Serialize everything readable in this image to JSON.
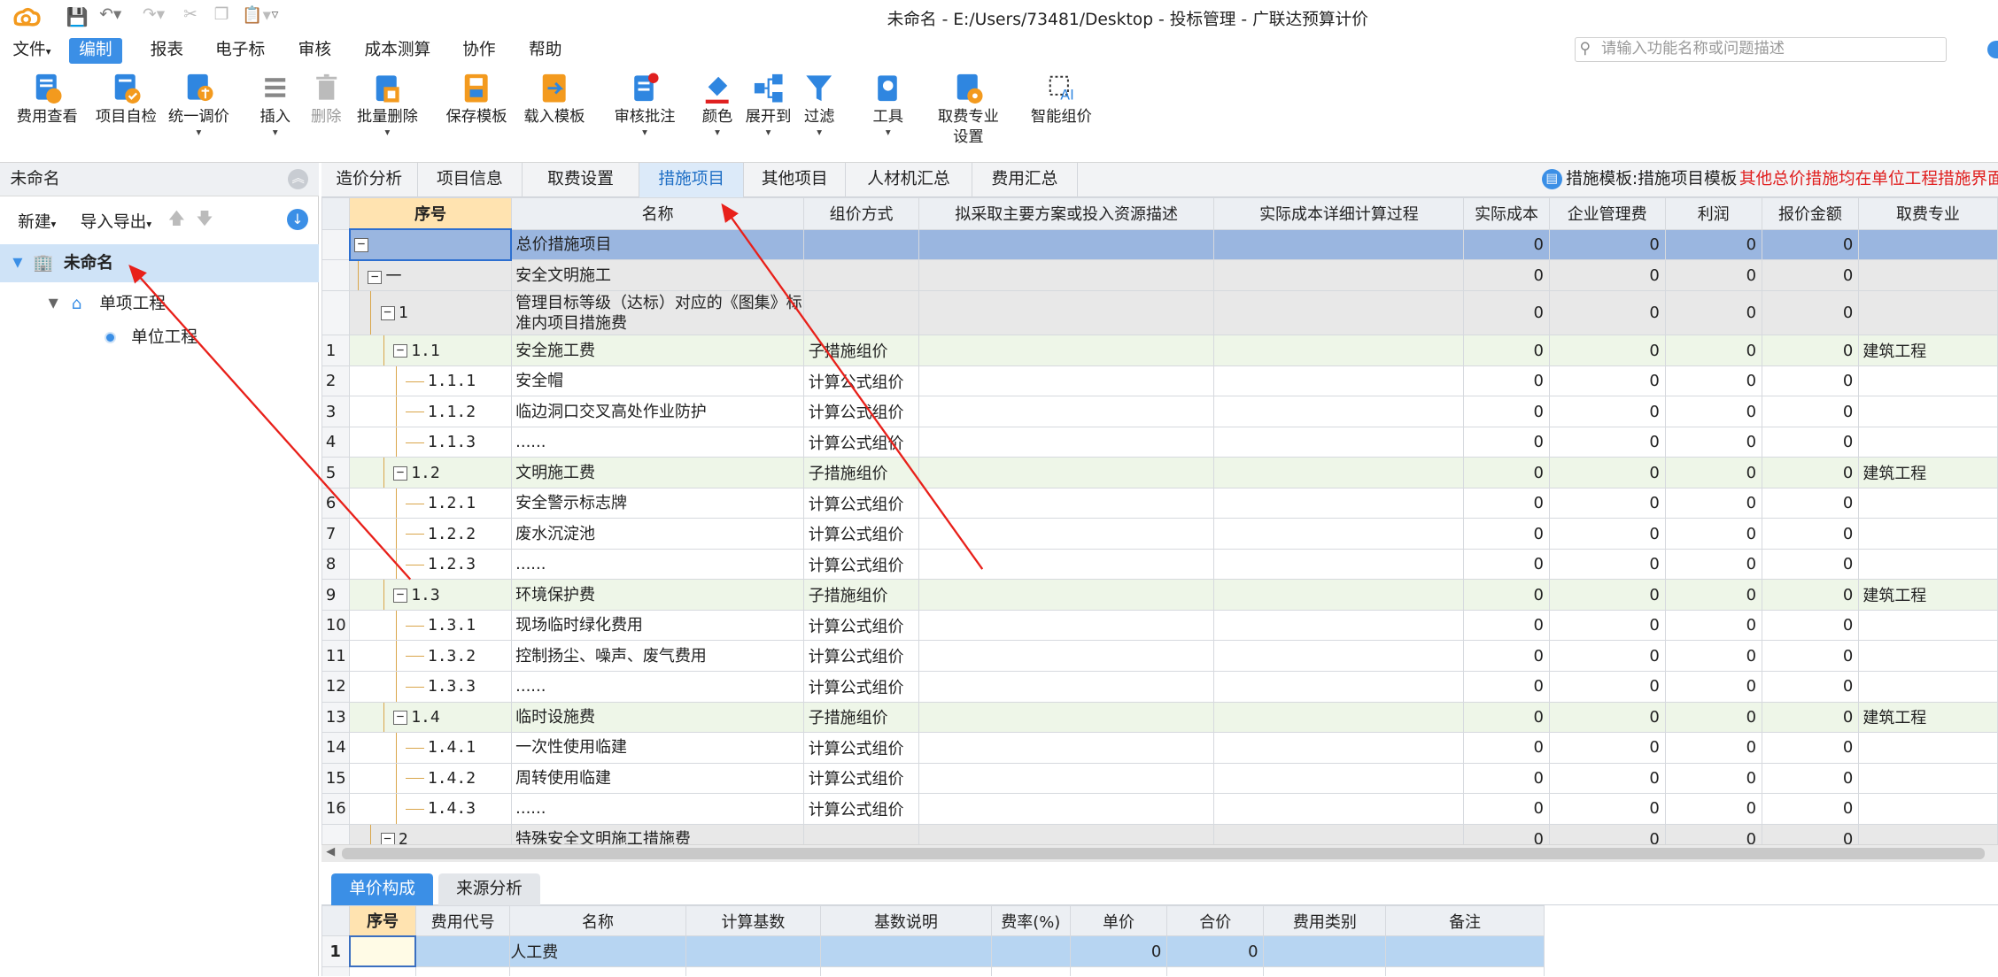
{
  "window": {
    "title": "未命名 - E:/Users/73481/Desktop - 投标管理 - 广联达预算计价"
  },
  "menu": [
    "文件",
    "编制",
    "报表",
    "电子标",
    "审核",
    "成本测算",
    "协作",
    "帮助"
  ],
  "search": {
    "placeholder": "请输入功能名称或问题描述"
  },
  "ribbon": [
    {
      "label": "费用查看",
      "icon": "fee-view-icon"
    },
    {
      "label": "项目自检",
      "icon": "project-check-icon"
    },
    {
      "label": "统一调价",
      "icon": "unified-price-icon"
    },
    {
      "label": "插入",
      "icon": "insert-icon"
    },
    {
      "label": "删除",
      "icon": "delete-icon"
    },
    {
      "label": "批量删除",
      "icon": "batch-delete-icon"
    },
    {
      "label": "保存模板",
      "icon": "save-template-icon"
    },
    {
      "label": "载入模板",
      "icon": "load-template-icon"
    },
    {
      "label": "审核批注",
      "icon": "review-note-icon"
    },
    {
      "label": "颜色",
      "icon": "color-bucket-icon"
    },
    {
      "label": "展开到",
      "icon": "expand-to-icon"
    },
    {
      "label": "过滤",
      "icon": "filter-icon"
    },
    {
      "label": "工具",
      "icon": "tools-icon"
    },
    {
      "label": "取费专业",
      "label2": "设置",
      "icon": "fee-setting-icon"
    },
    {
      "label": "智能组价",
      "icon": "ai-pricing-icon"
    }
  ],
  "sidebar": {
    "header": "未命名",
    "new_label": "新建",
    "import_export_label": "导入导出",
    "tree": [
      {
        "label": "未命名",
        "level": 0
      },
      {
        "label": "单项工程",
        "level": 1
      },
      {
        "label": "单位工程",
        "level": 2
      }
    ]
  },
  "tabs": [
    "造价分析",
    "项目信息",
    "取费设置",
    "措施项目",
    "其他项目",
    "人材机汇总",
    "费用汇总"
  ],
  "template_info": "措施模板:措施项目模板",
  "notice": "其他总价措施均在单位工程措施界面",
  "columns": [
    "序号",
    "名称",
    "组价方式",
    "拟采取主要方案或投入资源描述",
    "实际成本详细计算过程",
    "实际成本",
    "企业管理费",
    "利润",
    "报价金额",
    "取费专业"
  ],
  "rows": [
    {
      "idx": "",
      "code": "",
      "depth": 0,
      "box": "−",
      "name": "总价措施项目",
      "mode": "",
      "cost": "0",
      "mgmt": "0",
      "profit": "0",
      "amount": "0",
      "spec": "",
      "kind": "lvl0"
    },
    {
      "idx": "",
      "code": "一",
      "depth": 1,
      "box": "−",
      "name": "安全文明施工",
      "mode": "",
      "cost": "0",
      "mgmt": "0",
      "profit": "0",
      "amount": "0",
      "spec": "",
      "kind": "lvl1"
    },
    {
      "idx": "",
      "code": "1",
      "depth": 2,
      "box": "−",
      "name": "管理目标等级（达标）对应的《图集》标准内项目措施费",
      "mode": "",
      "cost": "0",
      "mgmt": "0",
      "profit": "0",
      "amount": "0",
      "spec": "",
      "kind": "lvl1",
      "tall": true
    },
    {
      "idx": "1",
      "code": "1.1",
      "depth": 3,
      "box": "−",
      "name": "安全施工费",
      "mode": "子措施组价",
      "cost": "0",
      "mgmt": "0",
      "profit": "0",
      "amount": "0",
      "spec": "建筑工程",
      "kind": "sub"
    },
    {
      "idx": "2",
      "code": "1.1.1",
      "depth": 4,
      "box": "",
      "name": "安全帽",
      "mode": "计算公式组价",
      "cost": "0",
      "mgmt": "0",
      "profit": "0",
      "amount": "0",
      "spec": "",
      "kind": "leaf"
    },
    {
      "idx": "3",
      "code": "1.1.2",
      "depth": 4,
      "box": "",
      "name": "临边洞口交叉高处作业防护",
      "mode": "计算公式组价",
      "cost": "0",
      "mgmt": "0",
      "profit": "0",
      "amount": "0",
      "spec": "",
      "kind": "leaf"
    },
    {
      "idx": "4",
      "code": "1.1.3",
      "depth": 4,
      "box": "",
      "name": "......",
      "mode": "计算公式组价",
      "cost": "0",
      "mgmt": "0",
      "profit": "0",
      "amount": "0",
      "spec": "",
      "kind": "leaf"
    },
    {
      "idx": "5",
      "code": "1.2",
      "depth": 3,
      "box": "−",
      "name": "文明施工费",
      "mode": "子措施组价",
      "cost": "0",
      "mgmt": "0",
      "profit": "0",
      "amount": "0",
      "spec": "建筑工程",
      "kind": "sub"
    },
    {
      "idx": "6",
      "code": "1.2.1",
      "depth": 4,
      "box": "",
      "name": "安全警示标志牌",
      "mode": "计算公式组价",
      "cost": "0",
      "mgmt": "0",
      "profit": "0",
      "amount": "0",
      "spec": "",
      "kind": "leaf"
    },
    {
      "idx": "7",
      "code": "1.2.2",
      "depth": 4,
      "box": "",
      "name": "废水沉淀池",
      "mode": "计算公式组价",
      "cost": "0",
      "mgmt": "0",
      "profit": "0",
      "amount": "0",
      "spec": "",
      "kind": "leaf"
    },
    {
      "idx": "8",
      "code": "1.2.3",
      "depth": 4,
      "box": "",
      "name": "......",
      "mode": "计算公式组价",
      "cost": "0",
      "mgmt": "0",
      "profit": "0",
      "amount": "0",
      "spec": "",
      "kind": "leaf"
    },
    {
      "idx": "9",
      "code": "1.3",
      "depth": 3,
      "box": "−",
      "name": "环境保护费",
      "mode": "子措施组价",
      "cost": "0",
      "mgmt": "0",
      "profit": "0",
      "amount": "0",
      "spec": "建筑工程",
      "kind": "sub"
    },
    {
      "idx": "10",
      "code": "1.3.1",
      "depth": 4,
      "box": "",
      "name": "现场临时绿化费用",
      "mode": "计算公式组价",
      "cost": "0",
      "mgmt": "0",
      "profit": "0",
      "amount": "0",
      "spec": "",
      "kind": "leaf"
    },
    {
      "idx": "11",
      "code": "1.3.2",
      "depth": 4,
      "box": "",
      "name": "控制扬尘、噪声、废气费用",
      "mode": "计算公式组价",
      "cost": "0",
      "mgmt": "0",
      "profit": "0",
      "amount": "0",
      "spec": "",
      "kind": "leaf"
    },
    {
      "idx": "12",
      "code": "1.3.3",
      "depth": 4,
      "box": "",
      "name": "......",
      "mode": "计算公式组价",
      "cost": "0",
      "mgmt": "0",
      "profit": "0",
      "amount": "0",
      "spec": "",
      "kind": "leaf"
    },
    {
      "idx": "13",
      "code": "1.4",
      "depth": 3,
      "box": "−",
      "name": "临时设施费",
      "mode": "子措施组价",
      "cost": "0",
      "mgmt": "0",
      "profit": "0",
      "amount": "0",
      "spec": "建筑工程",
      "kind": "sub"
    },
    {
      "idx": "14",
      "code": "1.4.1",
      "depth": 4,
      "box": "",
      "name": "一次性使用临建",
      "mode": "计算公式组价",
      "cost": "0",
      "mgmt": "0",
      "profit": "0",
      "amount": "0",
      "spec": "",
      "kind": "leaf"
    },
    {
      "idx": "15",
      "code": "1.4.2",
      "depth": 4,
      "box": "",
      "name": "周转使用临建",
      "mode": "计算公式组价",
      "cost": "0",
      "mgmt": "0",
      "profit": "0",
      "amount": "0",
      "spec": "",
      "kind": "leaf"
    },
    {
      "idx": "16",
      "code": "1.4.3",
      "depth": 4,
      "box": "",
      "name": "......",
      "mode": "计算公式组价",
      "cost": "0",
      "mgmt": "0",
      "profit": "0",
      "amount": "0",
      "spec": "",
      "kind": "leaf"
    },
    {
      "idx": "",
      "code": "2",
      "depth": 2,
      "box": "−",
      "name": "特殊安全文明施工措施费",
      "mode": "",
      "cost": "0",
      "mgmt": "0",
      "profit": "0",
      "amount": "0",
      "spec": "",
      "kind": "lvl1"
    }
  ],
  "bottom": {
    "tabs": [
      "单价构成",
      "来源分析"
    ],
    "columns": [
      "序号",
      "费用代号",
      "名称",
      "计算基数",
      "基数说明",
      "费率(%)",
      "单价",
      "合价",
      "费用类别",
      "备注"
    ],
    "rows": [
      {
        "idx": "1",
        "code": "",
        "name": "人工费",
        "base": "",
        "desc": "",
        "rate": "",
        "price": "0",
        "total": "0",
        "kind": "",
        "note": ""
      }
    ]
  },
  "colors": {
    "accent": "#3b8fe6",
    "annotation": "#e8201a",
    "notice": "#e02020"
  }
}
